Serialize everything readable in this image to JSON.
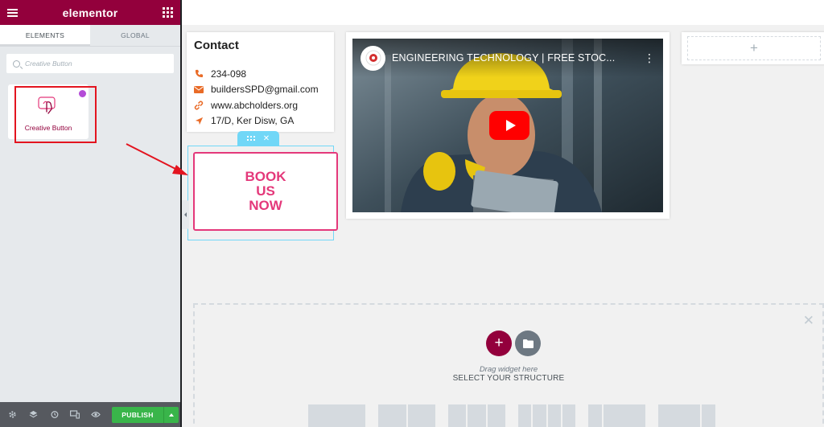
{
  "app": {
    "logo": "elementor"
  },
  "tabs": [
    {
      "label": "ELEMENTS",
      "active": true
    },
    {
      "label": "GLOBAL",
      "active": false
    }
  ],
  "search": {
    "placeholder": "Creative Button",
    "value": ""
  },
  "widget": {
    "label": "Creative Button",
    "badge_color": "#b44cd7"
  },
  "bottom": {
    "publish_label": "PUBLISH"
  },
  "contact": {
    "title": "Contact",
    "phone": "234-098",
    "email": "buildersSPD@gmail.com",
    "website": "www.abcholders.org",
    "address": "17/D, Ker Disw, GA",
    "icon_color": "#e96b27"
  },
  "video": {
    "title": "ENGINEERING TECHNOLOGY | FREE STOC..."
  },
  "book_button": {
    "label": "BOOK US NOW",
    "color": "#e4387a"
  },
  "drop_zone": {
    "drag_text": "Drag widget here",
    "structure_text": "SELECT YOUR STRUCTURE"
  },
  "colors": {
    "brand": "#93003c",
    "publish": "#39b54a",
    "selection": "#71d7f7",
    "highlight": "#e3141f"
  }
}
